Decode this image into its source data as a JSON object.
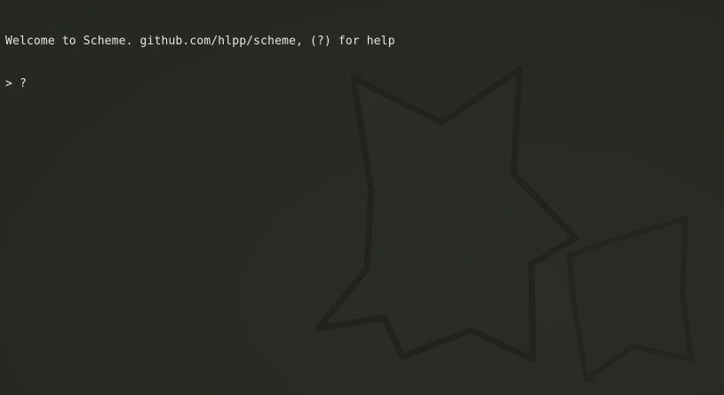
{
  "terminal": {
    "welcome_text": "Welcome to Scheme. github.com/hlpp/scheme, (?) for help",
    "prompt_symbol": ">",
    "input_text": "?",
    "background_art": "star-silhouette"
  },
  "colors": {
    "background": "#282924",
    "foreground": "#e6e6e2",
    "art_outline": "#1f201c"
  }
}
